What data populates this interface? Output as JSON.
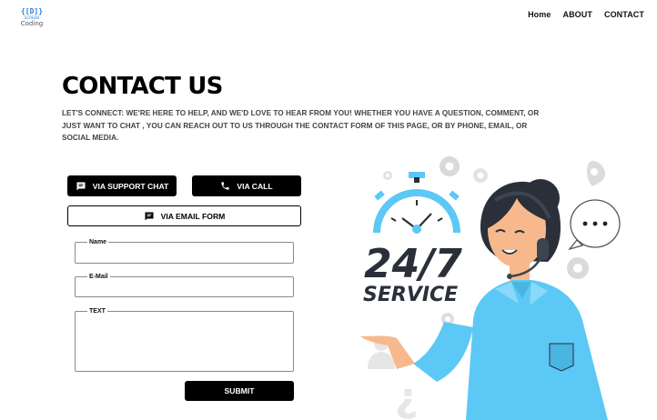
{
  "logo": {
    "top": "{[D]}",
    "middle": "SCREEN",
    "bottom": "Coding"
  },
  "nav": {
    "home": "Home",
    "about": "ABOUT",
    "contact": "CONTACT"
  },
  "page": {
    "title": "CONTACT US",
    "intro": "LET'S CONNECT: WE'RE HERE TO HELP, AND WE'D LOVE TO HEAR FROM YOU! WHETHER YOU HAVE A QUESTION, COMMENT, OR JUST WANT TO CHAT , YOU CAN REACH OUT TO US THROUGH THE CONTACT FORM OF THIS PAGE, OR BY PHONE, EMAIL, OR SOCIAL MEDIA."
  },
  "contact_options": {
    "chat": "VIA SUPPORT CHAT",
    "call": "VIA CALL",
    "email": "VIA EMAIL FORM"
  },
  "form": {
    "name_label": "Name",
    "name_value": "",
    "email_label": "E-Mail",
    "email_value": "",
    "text_label": "TEXT",
    "text_value": "",
    "submit": "SUBMIT"
  },
  "illustration": {
    "headline": "24/7",
    "subline": "SERVICE",
    "icons": [
      "stopwatch-icon",
      "gear-icon",
      "map-pin-icon",
      "speech-bubble-icon",
      "user-icon",
      "question-mark-icon",
      "headset-icon"
    ]
  },
  "colors": {
    "accent": "#5cc8f5",
    "dark": "#2a2f3a",
    "skin": "#f7b98b",
    "button": "#000000"
  }
}
